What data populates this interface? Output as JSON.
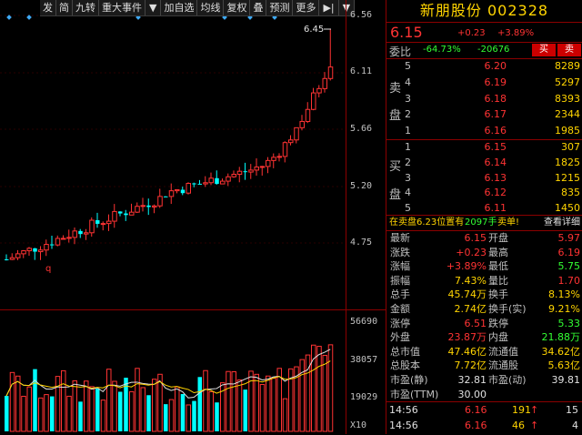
{
  "toolbar": {
    "items": [
      "发",
      "简",
      "九转",
      "重大事件",
      "▼",
      "加自选",
      "均线",
      "复权",
      "叠",
      "预测",
      "更多",
      "▶|",
      "▼"
    ]
  },
  "price_axis": [
    "6.56",
    "6.11",
    "5.66",
    "5.20",
    "4.75"
  ],
  "vol_axis": [
    "56690",
    "38057",
    "19029",
    "X10"
  ],
  "chart": {
    "high_label": "6.45",
    "low_marker": "q"
  },
  "quote": {
    "title": "新朋股份  002328",
    "price": "6.15",
    "change": "+0.23",
    "change_pct": "+3.89%",
    "weibi_label": "委比",
    "weibi_value": "-64.73%",
    "weicha_value": "-20676",
    "buy_btn": "买",
    "sell_btn": "卖",
    "sell_side_label": [
      "卖",
      "盘"
    ],
    "buy_side_label": [
      "买",
      "盘"
    ],
    "asks": [
      {
        "idx": "5",
        "price": "6.20",
        "vol": "8289"
      },
      {
        "idx": "4",
        "price": "6.19",
        "vol": "5297"
      },
      {
        "idx": "3",
        "price": "6.18",
        "vol": "8393"
      },
      {
        "idx": "2",
        "price": "6.17",
        "vol": "2344"
      },
      {
        "idx": "1",
        "price": "6.16",
        "vol": "1985"
      }
    ],
    "bids": [
      {
        "idx": "1",
        "price": "6.15",
        "vol": "307"
      },
      {
        "idx": "2",
        "price": "6.14",
        "vol": "1825"
      },
      {
        "idx": "3",
        "price": "6.13",
        "vol": "1215"
      },
      {
        "idx": "4",
        "price": "6.12",
        "vol": "835"
      },
      {
        "idx": "5",
        "price": "6.11",
        "vol": "1450"
      }
    ],
    "notice_a": "在卖盘6.23位置有",
    "notice_b": "2097手",
    "notice_c": "卖单!",
    "notice_link": "查看详细",
    "stats": [
      {
        "l1": "最新",
        "v1": "6.15",
        "c1": "red",
        "l2": "开盘",
        "v2": "5.97",
        "c2": "red"
      },
      {
        "l1": "涨跌",
        "v1": "+0.23",
        "c1": "red",
        "l2": "最高",
        "v2": "6.19",
        "c2": "red"
      },
      {
        "l1": "涨幅",
        "v1": "+3.89%",
        "c1": "red",
        "l2": "最低",
        "v2": "5.75",
        "c2": "grn"
      },
      {
        "l1": "振幅",
        "v1": "7.43%",
        "c1": "yel",
        "l2": "量比",
        "v2": "1.70",
        "c2": "red"
      },
      {
        "l1": "总手",
        "v1": "45.74万",
        "c1": "yel",
        "l2": "换手",
        "v2": "8.13%",
        "c2": "yel"
      },
      {
        "l1": "金额",
        "v1": "2.74亿",
        "c1": "yel",
        "l2": "换手(实)",
        "v2": "9.21%",
        "c2": "yel"
      },
      {
        "l1": "涨停",
        "v1": "6.51",
        "c1": "red",
        "l2": "跌停",
        "v2": "5.33",
        "c2": "grn"
      },
      {
        "l1": "外盘",
        "v1": "23.87万",
        "c1": "red",
        "l2": "内盘",
        "v2": "21.88万",
        "c2": "grn"
      },
      {
        "l1": "总市值",
        "v1": "47.46亿",
        "c1": "yel",
        "l2": "流通值",
        "v2": "34.62亿",
        "c2": "yel"
      },
      {
        "l1": "总股本",
        "v1": "7.72亿",
        "c1": "yel",
        "l2": "流通股",
        "v2": "5.63亿",
        "c2": "yel"
      },
      {
        "l1": "市盈(静)",
        "v1": "32.81",
        "c1": "wht",
        "l2": "市盈(动)",
        "v2": "39.81",
        "c2": "wht"
      },
      {
        "l1": "市盈(TTM)",
        "v1": "30.00",
        "c1": "wht",
        "l2": "",
        "v2": "",
        "c2": "wht"
      }
    ],
    "ticks": [
      {
        "time": "14:56",
        "price": "6.16",
        "vol": "191",
        "arrow": "↑",
        "n": "15"
      },
      {
        "time": "14:56",
        "price": "6.16",
        "vol": "46",
        "arrow": "↑",
        "n": "4"
      }
    ]
  },
  "colors": {
    "up": "#ff3333",
    "down": "#00ffff",
    "ma5": "#ffffff",
    "ma10": "#ffd400",
    "grid": "#8b0000"
  }
}
